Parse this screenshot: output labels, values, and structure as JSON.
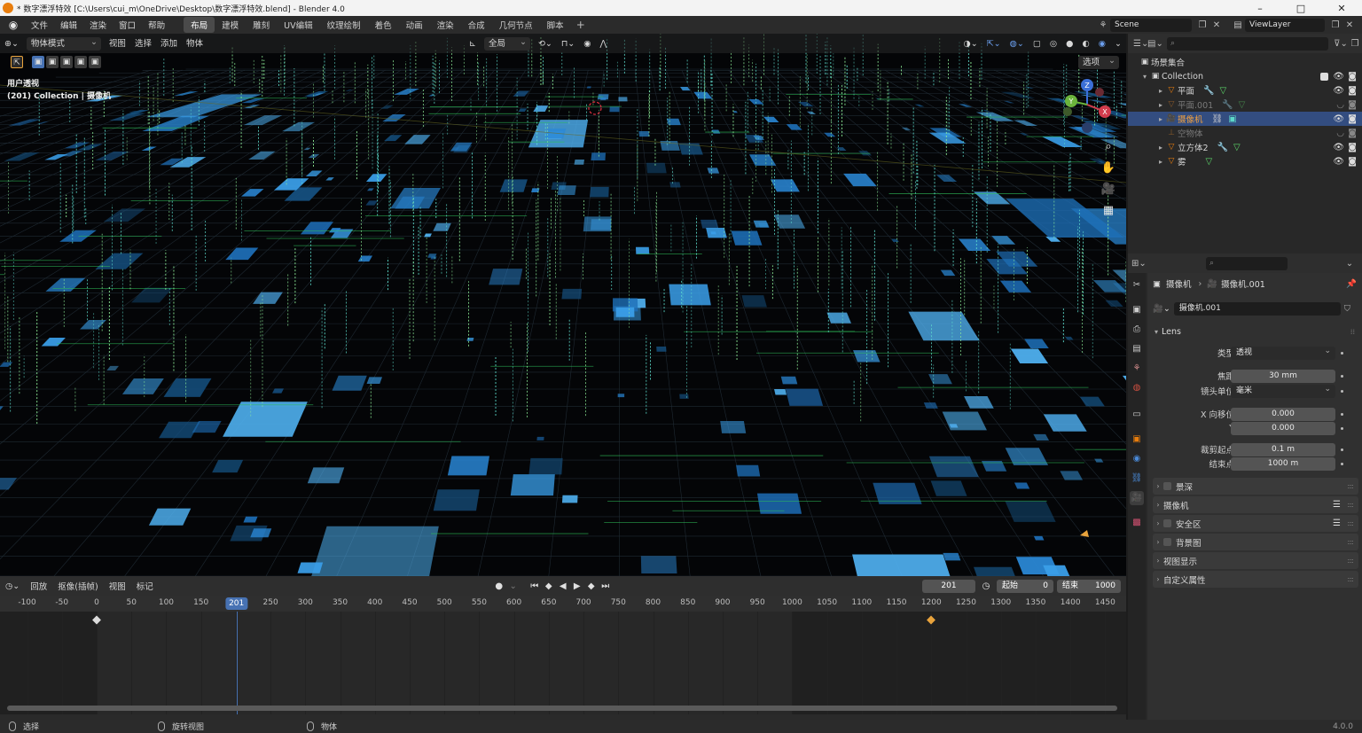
{
  "window": {
    "title": "* 数字漂浮特效 [C:\\Users\\cui_m\\OneDrive\\Desktop\\数字漂浮特效.blend] - Blender 4.0",
    "minimize": "–",
    "maximize": "□",
    "close": "✕"
  },
  "menubar": {
    "items": [
      "文件",
      "编辑",
      "渲染",
      "窗口",
      "帮助"
    ],
    "workspaces": [
      "布局",
      "建模",
      "雕刻",
      "UV编辑",
      "纹理绘制",
      "着色",
      "动画",
      "渲染",
      "合成",
      "几何节点",
      "脚本"
    ],
    "active_workspace": "布局",
    "add_workspace": "+",
    "scene": "Scene",
    "view_layer": "ViewLayer"
  },
  "viewport": {
    "mode": "物体模式",
    "menus": [
      "视图",
      "选择",
      "添加",
      "物体"
    ],
    "transform_orientation": "全局",
    "options_label": "选项",
    "info_line1": "用户透视",
    "info_line2": "(201) Collection | 摄像机",
    "gizmo": {
      "x": "X",
      "y": "Y",
      "z": "Z"
    }
  },
  "timeline": {
    "playback": "回放",
    "keying": "抠像(插帧)",
    "menus": [
      "视图",
      "标记"
    ],
    "current_frame": "201",
    "start_label": "起始",
    "start_frame": "0",
    "end_label": "结束",
    "end_frame": "1000",
    "ticks": [
      "-100",
      "-50",
      "0",
      "50",
      "100",
      "150",
      "200",
      "250",
      "300",
      "350",
      "400",
      "450",
      "500",
      "550",
      "600",
      "650",
      "700",
      "750",
      "800",
      "850",
      "900",
      "950",
      "1000",
      "1050",
      "1100",
      "1150",
      "1200",
      "1250",
      "1300",
      "1350",
      "1400",
      "1450"
    ],
    "playhead_label": "201",
    "keyframes": [
      0,
      1200
    ]
  },
  "statusbar": {
    "select": "选择",
    "rotate": "旋转视图",
    "object": "物体",
    "version": "4.0.0"
  },
  "outliner": {
    "scene_collection": "场景集合",
    "collection": "Collection",
    "items": [
      {
        "name": "平面",
        "dim": false,
        "selected": false
      },
      {
        "name": "平面.001",
        "dim": true,
        "selected": false
      },
      {
        "name": "摄像机",
        "dim": false,
        "selected": true
      },
      {
        "name": "空物体",
        "dim": true,
        "selected": false
      },
      {
        "name": "立方体2",
        "dim": false,
        "selected": false
      },
      {
        "name": "雾",
        "dim": false,
        "selected": false
      }
    ]
  },
  "properties": {
    "breadcrumb_object": "摄像机",
    "breadcrumb_data": "摄像机.001",
    "data_name": "摄像机.001",
    "lens_panel": "Lens",
    "type_label": "类型",
    "type_value": "透视",
    "focal_label": "焦距",
    "focal_value": "30 mm",
    "lens_unit_label": "镜头单位",
    "lens_unit_value": "毫米",
    "shift_x_label": "X 向移位",
    "shift_x_value": "0.000",
    "shift_y_label": "Y",
    "shift_y_value": "0.000",
    "clip_start_label": "裁剪起点",
    "clip_start_value": "0.1 m",
    "clip_end_label": "结束点",
    "clip_end_value": "1000 m",
    "panels": [
      "景深",
      "摄像机",
      "安全区",
      "背景图",
      "视图显示",
      "自定义属性"
    ]
  },
  "colors": {
    "accent": "#4772b3",
    "selected_row": "#334d80",
    "object_orange": "#e87d0d",
    "keyframe": "#e8a33c"
  }
}
